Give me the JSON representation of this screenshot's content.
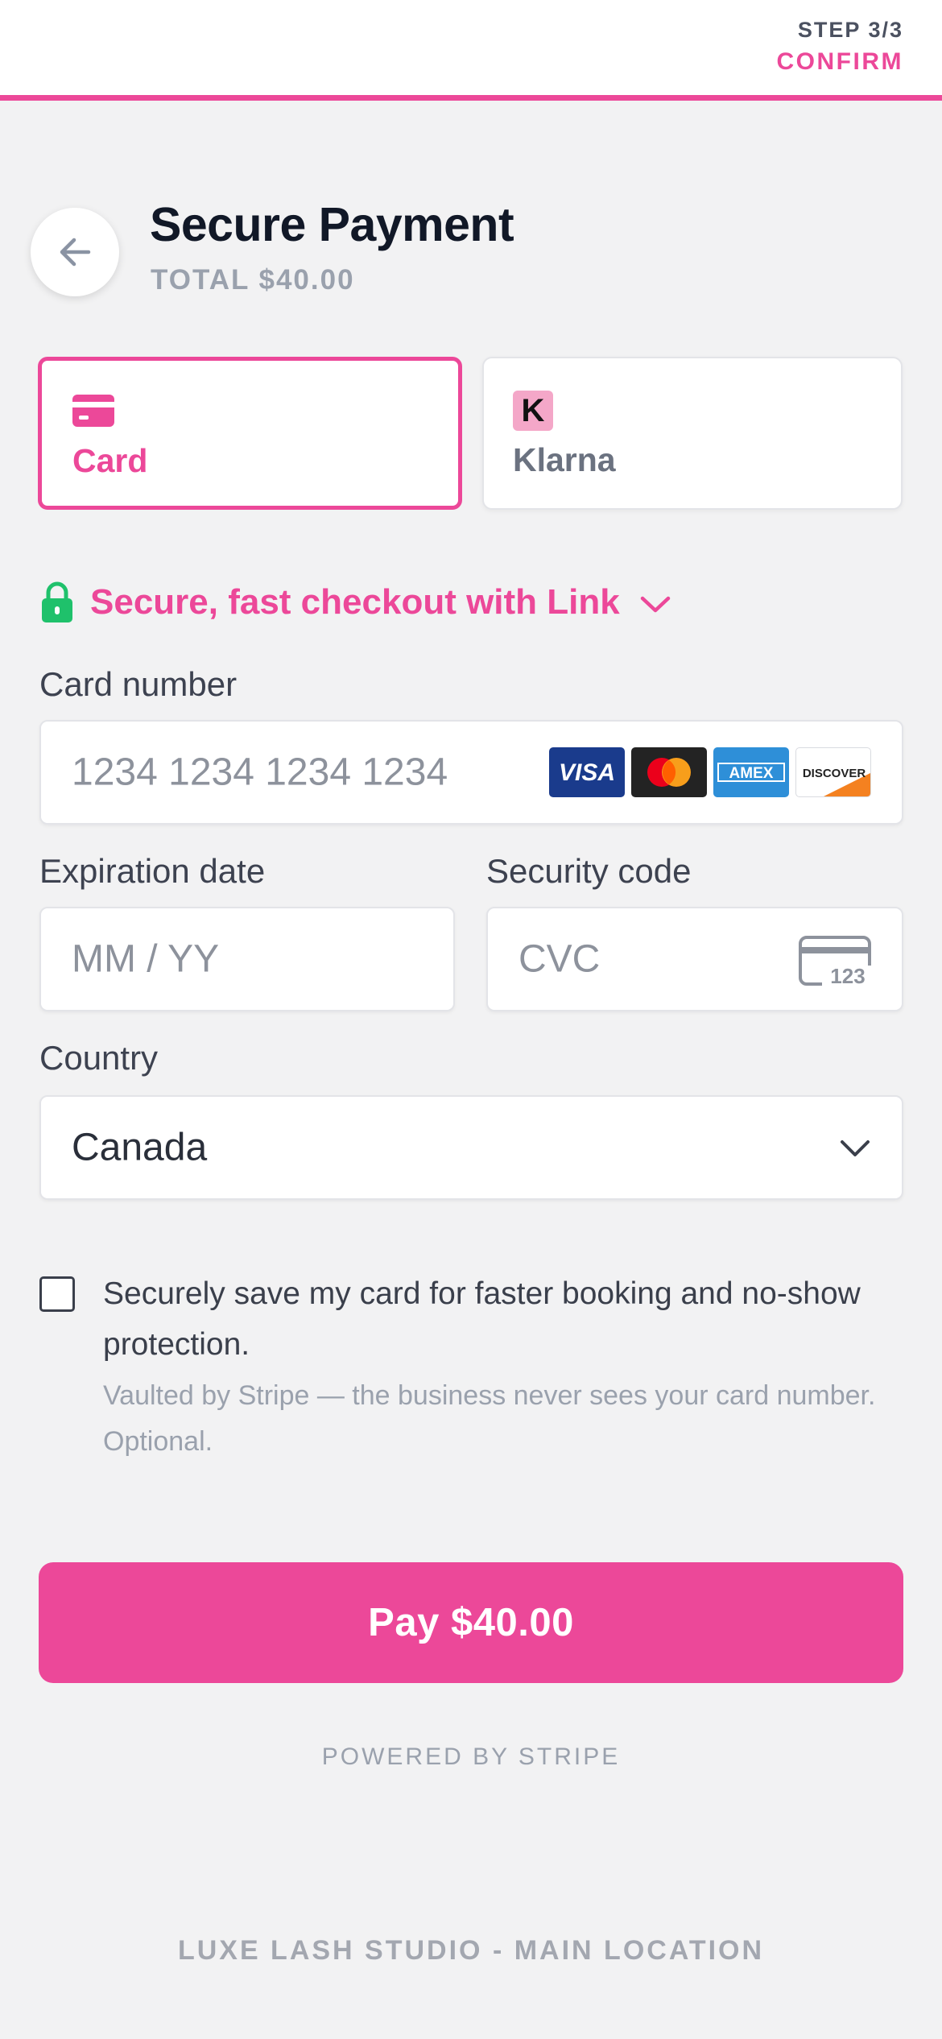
{
  "header": {
    "step_label": "STEP 3/3",
    "step_name": "CONFIRM",
    "accent_color": "#ec4899"
  },
  "page": {
    "title": "Secure Payment",
    "total": "TOTAL $40.00",
    "back_icon": "arrow-left-icon"
  },
  "payment_methods": [
    {
      "label": "Card",
      "icon": "credit-card-icon",
      "selected": true
    },
    {
      "label": "Klarna",
      "icon": "klarna-logo",
      "badge": "K",
      "selected": false
    }
  ],
  "link": {
    "text": "Secure, fast checkout with Link",
    "icon": "lock-icon",
    "chevron": "chevron-down-icon"
  },
  "form": {
    "card_number": {
      "label": "Card number",
      "placeholder": "1234 1234 1234 1234",
      "brands": [
        "VISA",
        "Mastercard",
        "AMEX",
        "DISCOVER"
      ]
    },
    "expiration": {
      "label": "Expiration date",
      "placeholder": "MM / YY"
    },
    "security_code": {
      "label": "Security code",
      "placeholder": "CVC",
      "icon_text": "123"
    },
    "country": {
      "label": "Country",
      "value": "Canada"
    }
  },
  "save_card": {
    "checked": false,
    "text": "Securely save my card for faster booking and no-show protection.",
    "subtext": "Vaulted by Stripe — the business never sees your card number. Optional."
  },
  "pay_button": "Pay $40.00",
  "powered_by": "POWERED BY STRIPE",
  "footer_location": "LUXE LASH STUDIO - MAIN LOCATION"
}
